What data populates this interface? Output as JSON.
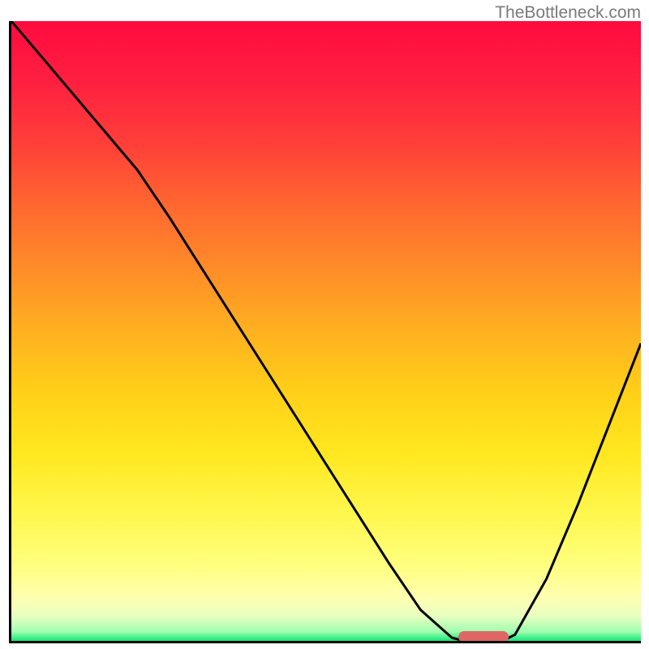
{
  "watermark": "TheBottleneck.com",
  "chart_data": {
    "type": "line",
    "title": "",
    "xlabel": "",
    "ylabel": "",
    "xlim": [
      0,
      100
    ],
    "ylim": [
      0,
      100
    ],
    "x": [
      0,
      5,
      10,
      15,
      20,
      22,
      25,
      30,
      35,
      40,
      45,
      50,
      55,
      60,
      65,
      70,
      72,
      75,
      78,
      80,
      85,
      90,
      95,
      100
    ],
    "values": [
      100,
      94,
      88,
      82,
      76,
      73,
      68.5,
      60.5,
      52.5,
      44.5,
      36.5,
      28.5,
      20.5,
      12.5,
      5,
      0.5,
      0,
      0,
      0,
      1,
      10,
      22,
      35,
      48
    ],
    "optimal_range": {
      "start": 71,
      "end": 79,
      "value": 0
    },
    "gradient_stops": [
      {
        "pos": 0.0,
        "color": "#ff0b3f"
      },
      {
        "pos": 0.1,
        "color": "#ff2040"
      },
      {
        "pos": 0.2,
        "color": "#ff4038"
      },
      {
        "pos": 0.3,
        "color": "#ff6830"
      },
      {
        "pos": 0.4,
        "color": "#ff8c28"
      },
      {
        "pos": 0.5,
        "color": "#ffb020"
      },
      {
        "pos": 0.6,
        "color": "#ffd018"
      },
      {
        "pos": 0.7,
        "color": "#ffe820"
      },
      {
        "pos": 0.8,
        "color": "#fff850"
      },
      {
        "pos": 0.88,
        "color": "#ffff80"
      },
      {
        "pos": 0.93,
        "color": "#ffffb0"
      },
      {
        "pos": 0.96,
        "color": "#e8ffc0"
      },
      {
        "pos": 0.985,
        "color": "#a0ffb0"
      },
      {
        "pos": 1.0,
        "color": "#10e878"
      }
    ]
  }
}
